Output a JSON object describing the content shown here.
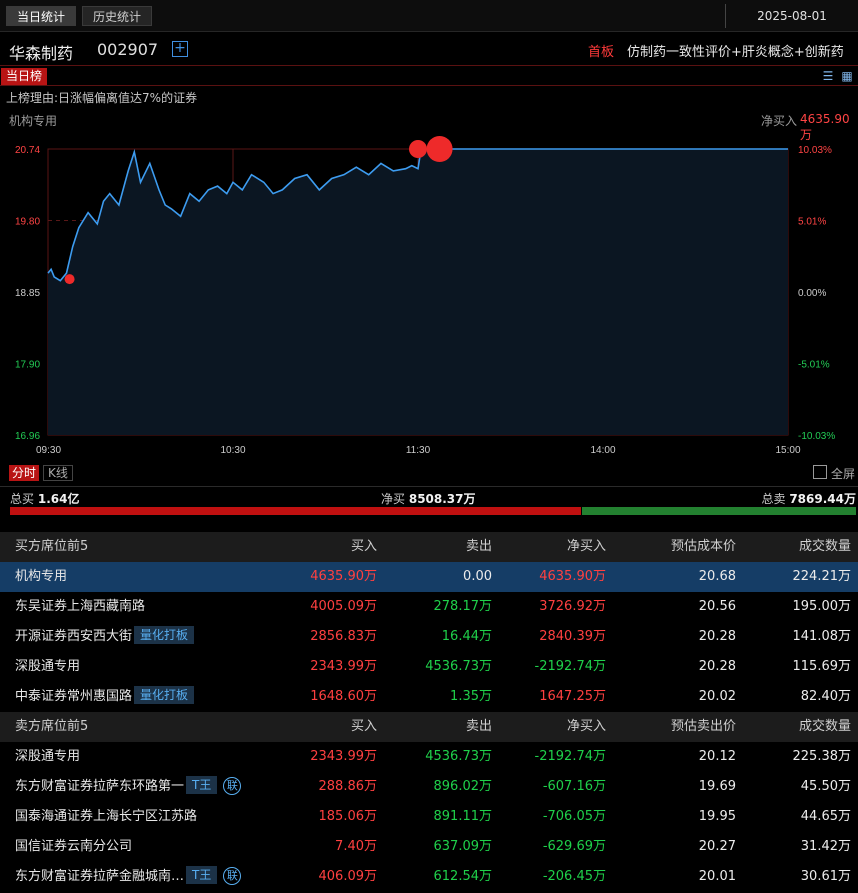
{
  "top_tabs": [
    "当日统计",
    "历史统计"
  ],
  "date": "2025-08-01",
  "stock": {
    "name": "华森制药",
    "code": "002907",
    "add_symbol": "+",
    "board": "首板",
    "concepts": "仿制药一致性评价+肝炎概念+创新药"
  },
  "list_tag": "当日榜",
  "reason": "上榜理由:日涨幅偏离值达7%的证券",
  "chart": {
    "who": "机构专用",
    "net_label": "净买入",
    "net_value": "4635.90万"
  },
  "chart_data": {
    "type": "line",
    "y_ticks_left": [
      "20.74",
      "19.80",
      "18.85",
      "17.90",
      "16.96"
    ],
    "y_ticks_right": [
      "10.03%",
      "5.01%",
      "0.00%",
      "-5.01%",
      "-10.03%"
    ],
    "x_ticks": [
      "09:30",
      "10:30",
      "11:30",
      "14:00",
      "15:00"
    ],
    "ylim": [
      16.96,
      20.74
    ],
    "prev_close": 18.85,
    "x": [
      0,
      1,
      2,
      4,
      6,
      8,
      10,
      13,
      16,
      18,
      20,
      23,
      26,
      28,
      30,
      33,
      36,
      38,
      40,
      43,
      46,
      49,
      52,
      55,
      58,
      60,
      63,
      66,
      70,
      73,
      76,
      80,
      84,
      88,
      92,
      96,
      100,
      104,
      108,
      112,
      116,
      118,
      120,
      121,
      130,
      150,
      200,
      240
    ],
    "values": [
      19.1,
      19.15,
      19.05,
      19.0,
      19.1,
      19.45,
      19.7,
      19.9,
      19.75,
      20.05,
      20.15,
      20.0,
      20.45,
      20.7,
      20.3,
      20.55,
      20.2,
      20.0,
      19.95,
      19.85,
      20.15,
      20.05,
      20.2,
      20.25,
      20.15,
      20.3,
      20.2,
      20.4,
      20.3,
      20.15,
      20.2,
      20.35,
      20.4,
      20.2,
      20.35,
      20.4,
      20.5,
      20.4,
      20.55,
      20.45,
      20.48,
      20.52,
      20.48,
      20.74,
      20.74,
      20.74,
      20.74,
      20.74
    ],
    "markers": [
      {
        "x": 7,
        "y": 19.02,
        "size": "small"
      },
      {
        "x": 120,
        "y": 20.74,
        "size": "medium"
      },
      {
        "x": 127,
        "y": 20.74,
        "size": "large"
      }
    ]
  },
  "chart_tabs": {
    "fenshi": "分时",
    "kline": "K线",
    "fullscreen": "全屏"
  },
  "summary": {
    "total_buy_label": "总买",
    "total_buy": "1.64亿",
    "net_buy_label": "净买",
    "net_buy": "8508.37万",
    "total_sell_label": "总卖",
    "total_sell": "7869.44万",
    "buy_fraction": 0.675
  },
  "buy_table": {
    "headers": [
      "买方席位前5",
      "买入",
      "卖出",
      "净买入",
      "预估成本价",
      "成交数量"
    ],
    "rows": [
      {
        "name": "机构专用",
        "badge": "",
        "circle": "",
        "buy": "4635.90万",
        "sell": "0.00",
        "net": "4635.90万",
        "net_pos": true,
        "price": "20.68",
        "vol": "224.21万",
        "hl": true
      },
      {
        "name": "东吴证券上海西藏南路",
        "badge": "",
        "circle": "",
        "buy": "4005.09万",
        "sell": "278.17万",
        "net": "3726.92万",
        "net_pos": true,
        "price": "20.56",
        "vol": "195.00万",
        "hl": false
      },
      {
        "name": "开源证券西安西大街",
        "badge": "量化打板",
        "circle": "",
        "buy": "2856.83万",
        "sell": "16.44万",
        "net": "2840.39万",
        "net_pos": true,
        "price": "20.28",
        "vol": "141.08万",
        "hl": false
      },
      {
        "name": "深股通专用",
        "badge": "",
        "circle": "",
        "buy": "2343.99万",
        "sell": "4536.73万",
        "net": "-2192.74万",
        "net_pos": false,
        "price": "20.28",
        "vol": "115.69万",
        "hl": false
      },
      {
        "name": "中泰证券常州惠国路",
        "badge": "量化打板",
        "circle": "",
        "buy": "1648.60万",
        "sell": "1.35万",
        "net": "1647.25万",
        "net_pos": true,
        "price": "20.02",
        "vol": "82.40万",
        "hl": false
      }
    ]
  },
  "sell_table": {
    "headers": [
      "卖方席位前5",
      "买入",
      "卖出",
      "净买入",
      "预估卖出价",
      "成交数量"
    ],
    "rows": [
      {
        "name": "深股通专用",
        "badge": "",
        "circle": "",
        "buy": "2343.99万",
        "sell": "4536.73万",
        "net": "-2192.74万",
        "net_pos": false,
        "price": "20.12",
        "vol": "225.38万",
        "hl": false
      },
      {
        "name": "东方财富证券拉萨东环路第一",
        "badge": "T王",
        "circle": "联",
        "buy": "288.86万",
        "sell": "896.02万",
        "net": "-607.16万",
        "net_pos": false,
        "price": "19.69",
        "vol": "45.50万",
        "hl": false
      },
      {
        "name": "国泰海通证券上海长宁区江苏路",
        "badge": "",
        "circle": "",
        "buy": "185.06万",
        "sell": "891.11万",
        "net": "-706.05万",
        "net_pos": false,
        "price": "19.95",
        "vol": "44.65万",
        "hl": false
      },
      {
        "name": "国信证券云南分公司",
        "badge": "",
        "circle": "",
        "buy": "7.40万",
        "sell": "637.09万",
        "net": "-629.69万",
        "net_pos": false,
        "price": "20.27",
        "vol": "31.42万",
        "hl": false
      },
      {
        "name": "东方财富证券拉萨金融城南…",
        "badge": "T王",
        "circle": "联",
        "buy": "406.09万",
        "sell": "612.54万",
        "net": "-206.45万",
        "net_pos": false,
        "price": "20.01",
        "vol": "30.61万",
        "hl": false
      }
    ]
  }
}
